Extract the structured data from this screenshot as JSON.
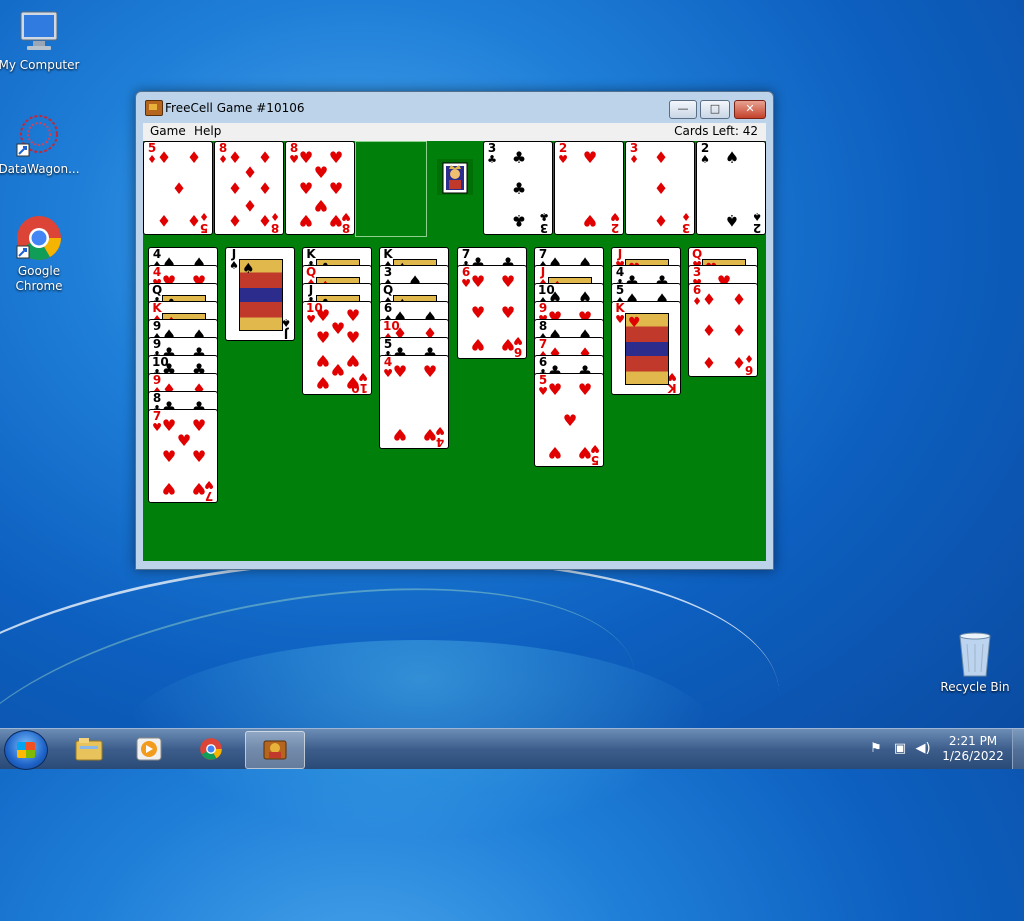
{
  "desktop": {
    "icons": [
      {
        "label": "My Computer",
        "icon": "computer-icon"
      },
      {
        "label": "DataWagon...",
        "icon": "datawagon-icon"
      },
      {
        "label": "Google Chrome",
        "icon": "chrome-icon"
      },
      {
        "label": "Recycle Bin",
        "icon": "recycle-bin-icon"
      }
    ]
  },
  "window": {
    "title": "FreeCell Game #10106",
    "controls": {
      "minimize": "—",
      "maximize": "□",
      "close": "✕"
    },
    "menu": [
      "Game",
      "Help"
    ],
    "cards_left": "Cards Left: 42"
  },
  "game": {
    "free_cells": [
      {
        "rank": "5",
        "suit": "♦",
        "color": "red"
      },
      {
        "rank": "8",
        "suit": "♦",
        "color": "red"
      },
      {
        "rank": "8",
        "suit": "♥",
        "color": "red"
      },
      null
    ],
    "foundations": [
      {
        "rank": "3",
        "suit": "♣",
        "color": "black"
      },
      {
        "rank": "2",
        "suit": "♥",
        "color": "red"
      },
      {
        "rank": "3",
        "suit": "♦",
        "color": "red"
      },
      {
        "rank": "2",
        "suit": "♠",
        "color": "black"
      }
    ],
    "columns": [
      [
        {
          "rank": "4",
          "suit": "♠",
          "color": "black"
        },
        {
          "rank": "4",
          "suit": "♥",
          "color": "red"
        },
        {
          "rank": "Q",
          "suit": "♣",
          "color": "black"
        },
        {
          "rank": "K",
          "suit": "♦",
          "color": "red"
        },
        {
          "rank": "9",
          "suit": "♠",
          "color": "black"
        },
        {
          "rank": "9",
          "suit": "♣",
          "color": "black"
        },
        {
          "rank": "10",
          "suit": "♣",
          "color": "black"
        },
        {
          "rank": "9",
          "suit": "♦",
          "color": "red"
        },
        {
          "rank": "8",
          "suit": "♣",
          "color": "black"
        },
        {
          "rank": "7",
          "suit": "♥",
          "color": "red"
        }
      ],
      [
        {
          "rank": "J",
          "suit": "♠",
          "color": "black"
        }
      ],
      [
        {
          "rank": "K",
          "suit": "♣",
          "color": "black"
        },
        {
          "rank": "Q",
          "suit": "♦",
          "color": "red"
        },
        {
          "rank": "J",
          "suit": "♣",
          "color": "black"
        },
        {
          "rank": "10",
          "suit": "♥",
          "color": "red"
        }
      ],
      [
        {
          "rank": "K",
          "suit": "♠",
          "color": "black"
        },
        {
          "rank": "3",
          "suit": "♠",
          "color": "black"
        },
        {
          "rank": "Q",
          "suit": "♠",
          "color": "black"
        },
        {
          "rank": "6",
          "suit": "♠",
          "color": "black"
        },
        {
          "rank": "10",
          "suit": "♦",
          "color": "red"
        },
        {
          "rank": "5",
          "suit": "♣",
          "color": "black"
        },
        {
          "rank": "4",
          "suit": "♥",
          "color": "red"
        }
      ],
      [
        {
          "rank": "7",
          "suit": "♣",
          "color": "black"
        },
        {
          "rank": "6",
          "suit": "♥",
          "color": "red"
        }
      ],
      [
        {
          "rank": "7",
          "suit": "♠",
          "color": "black"
        },
        {
          "rank": "J",
          "suit": "♦",
          "color": "red"
        },
        {
          "rank": "10",
          "suit": "♠",
          "color": "black"
        },
        {
          "rank": "9",
          "suit": "♥",
          "color": "red"
        },
        {
          "rank": "8",
          "suit": "♠",
          "color": "black"
        },
        {
          "rank": "7",
          "suit": "♦",
          "color": "red"
        },
        {
          "rank": "6",
          "suit": "♣",
          "color": "black"
        },
        {
          "rank": "5",
          "suit": "♥",
          "color": "red"
        }
      ],
      [
        {
          "rank": "J",
          "suit": "♥",
          "color": "red"
        },
        {
          "rank": "4",
          "suit": "♣",
          "color": "black"
        },
        {
          "rank": "5",
          "suit": "♠",
          "color": "black"
        },
        {
          "rank": "K",
          "suit": "♥",
          "color": "red"
        }
      ],
      [
        {
          "rank": "Q",
          "suit": "♥",
          "color": "red"
        },
        {
          "rank": "3",
          "suit": "♥",
          "color": "red"
        },
        {
          "rank": "6",
          "suit": "♦",
          "color": "red"
        }
      ]
    ],
    "king_indicator_icon": "king-icon"
  },
  "taskbar": {
    "apps": [
      "windows-explorer-icon",
      "media-player-icon",
      "chrome-icon",
      "freecell-icon"
    ],
    "time": "2:21 PM",
    "date": "1/26/2022"
  },
  "colors": {
    "felt": "#00800b",
    "red_suit": "#e00000",
    "black_suit": "#000000"
  }
}
